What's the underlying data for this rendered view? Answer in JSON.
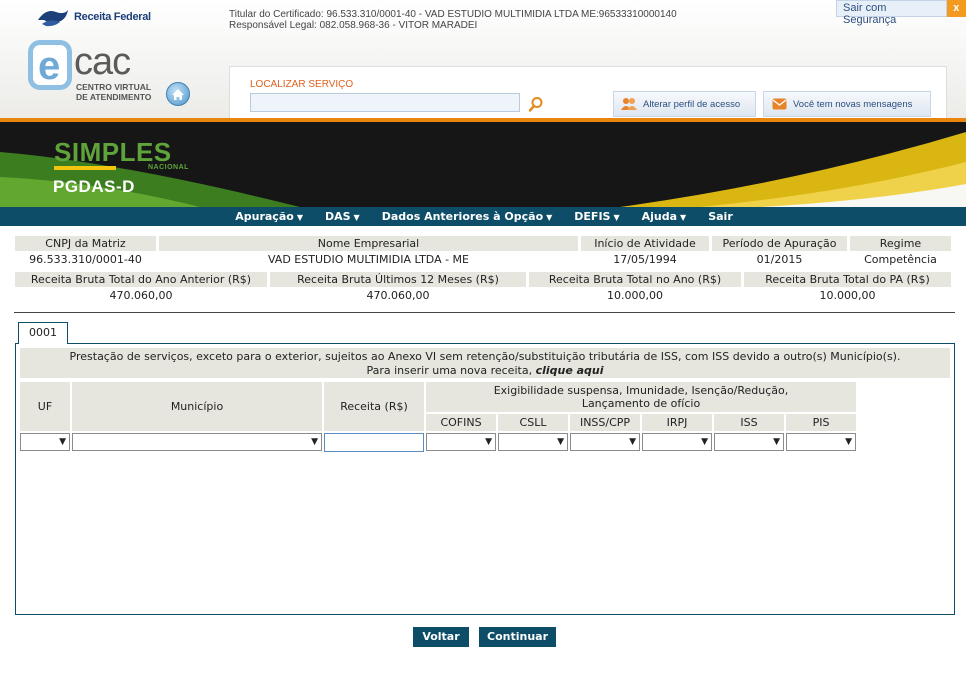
{
  "header": {
    "brand": "Receita Federal",
    "ecac_e": "e",
    "ecac_cac": "cac",
    "ecac_sub_1": "CENTRO VIRTUAL",
    "ecac_sub_2": "DE ATENDIMENTO",
    "cert_line_1": "Titular do Certificado: 96.533.310/0001-40 - VAD ESTUDIO MULTIMIDIA LTDA ME:96533310000140",
    "cert_line_2": "Responsável Legal: 082.058.968-36 - VITOR MARADEI",
    "logout": "Sair com Segurança",
    "logout_x": "x",
    "search_label": "LOCALIZAR SERVIÇO",
    "search_value": "",
    "profile_button": "Alterar perfil de acesso",
    "messages_button": "Você tem novas mensagens"
  },
  "banner": {
    "simples": "SIMPLES",
    "nacional": "NACIONAL",
    "app": "PGDAS-D"
  },
  "nav": {
    "items": [
      "Apuração",
      "DAS",
      "Dados Anteriores à Opção",
      "DEFIS",
      "Ajuda",
      "Sair"
    ],
    "dropdown_caret": "▼"
  },
  "summary": {
    "headers_1": [
      "CNPJ da Matriz",
      "Nome Empresarial",
      "Início de Atividade",
      "Período de Apuração",
      "Regime"
    ],
    "values_1": [
      "96.533.310/0001-40",
      "VAD ESTUDIO MULTIMIDIA LTDA - ME",
      "17/05/1994",
      "01/2015",
      "Competência"
    ],
    "headers_2": [
      "Receita Bruta Total do Ano Anterior (R$)",
      "Receita Bruta Últimos 12 Meses (R$)",
      "Receita Bruta Total no Ano (R$)",
      "Receita Bruta Total do PA (R$)"
    ],
    "values_2": [
      "470.060,00",
      "470.060,00",
      "10.000,00",
      "10.000,00"
    ]
  },
  "tab": {
    "label": "0001"
  },
  "panel": {
    "description": "Prestação de serviços, exceto para o exterior, sujeitos ao Anexo VI sem retenção/substituição tributária de ISS, com ISS devido a outro(s) Município(s).",
    "insert_prefix": "Para inserir uma nova receita,",
    "insert_link": "clique aqui",
    "col_uf": "UF",
    "col_municipio": "Município",
    "col_receita": "Receita (R$)",
    "col_group_1": "Exigibilidade suspensa, Imunidade, Isenção/Redução,",
    "col_group_2": "Lançamento de ofício",
    "sub_cols": [
      "COFINS",
      "CSLL",
      "INSS/CPP",
      "IRPJ",
      "ISS",
      "PIS"
    ],
    "receita_value": "",
    "select_arrow": "▼"
  },
  "buttons": {
    "back": "Voltar",
    "continue": "Continuar"
  }
}
